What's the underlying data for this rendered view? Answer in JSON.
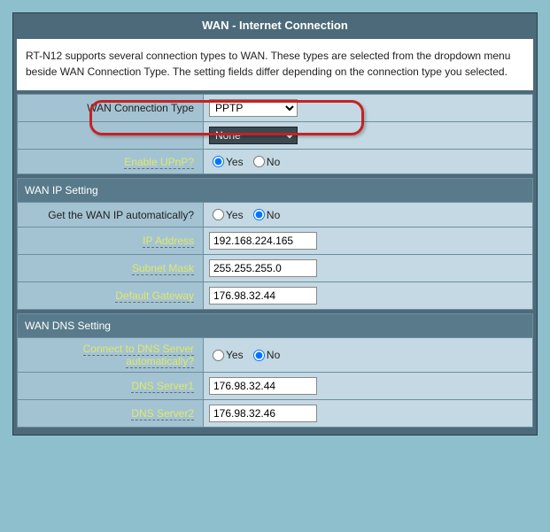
{
  "title": "WAN - Internet Connection",
  "intro": "RT-N12 supports several connection types to WAN. These types are selected from the dropdown menu beside WAN Connection Type. The setting fields differ depending on the connection type you selected.",
  "basic": {
    "wan_conn_label": "WAN Connection Type",
    "wan_conn_value": "PPTP",
    "stb_value": "None",
    "upnp_label": "Enable UPnP?",
    "upnp_yes": "Yes",
    "upnp_no": "No"
  },
  "ipSection": {
    "header": "WAN IP Setting",
    "auto_label": "Get the WAN IP automatically?",
    "auto_yes": "Yes",
    "auto_no": "No",
    "ip_label": "IP Address",
    "ip_value": "192.168.224.165",
    "mask_label": "Subnet Mask",
    "mask_value": "255.255.255.0",
    "gw_label": "Default Gateway",
    "gw_value": "176.98.32.44"
  },
  "dnsSection": {
    "header": "WAN DNS Setting",
    "auto_label": "Connect to DNS Server automatically?",
    "auto_yes": "Yes",
    "auto_no": "No",
    "dns1_label": "DNS Server1",
    "dns1_value": "176.98.32.44",
    "dns2_label": "DNS Server2",
    "dns2_value": "176.98.32.46"
  }
}
